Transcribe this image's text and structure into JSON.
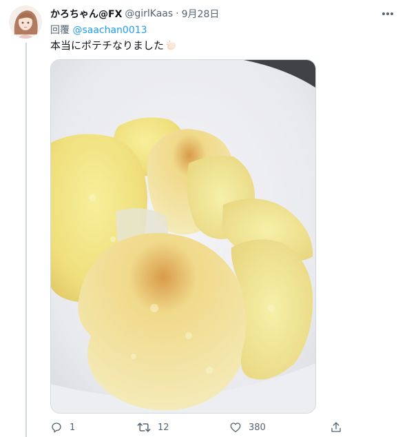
{
  "tweet": {
    "display_name": "かろちゃん@FX",
    "handle": "@girlKaas",
    "separator": "·",
    "date": "9月28日",
    "reply_label": "回覆",
    "reply_to": "@saachan0013",
    "text": "本当にポテチなりました",
    "text_emoji_icon": "clapping-hands-icon",
    "media_description_icon": "potato-chips-photo"
  },
  "actions": {
    "reply_count": "1",
    "retweet_count": "12",
    "like_count": "380"
  },
  "colors": {
    "text_primary": "#0f1419",
    "text_secondary": "#536471",
    "link": "#1d9bf0",
    "border": "#cfd9de"
  }
}
